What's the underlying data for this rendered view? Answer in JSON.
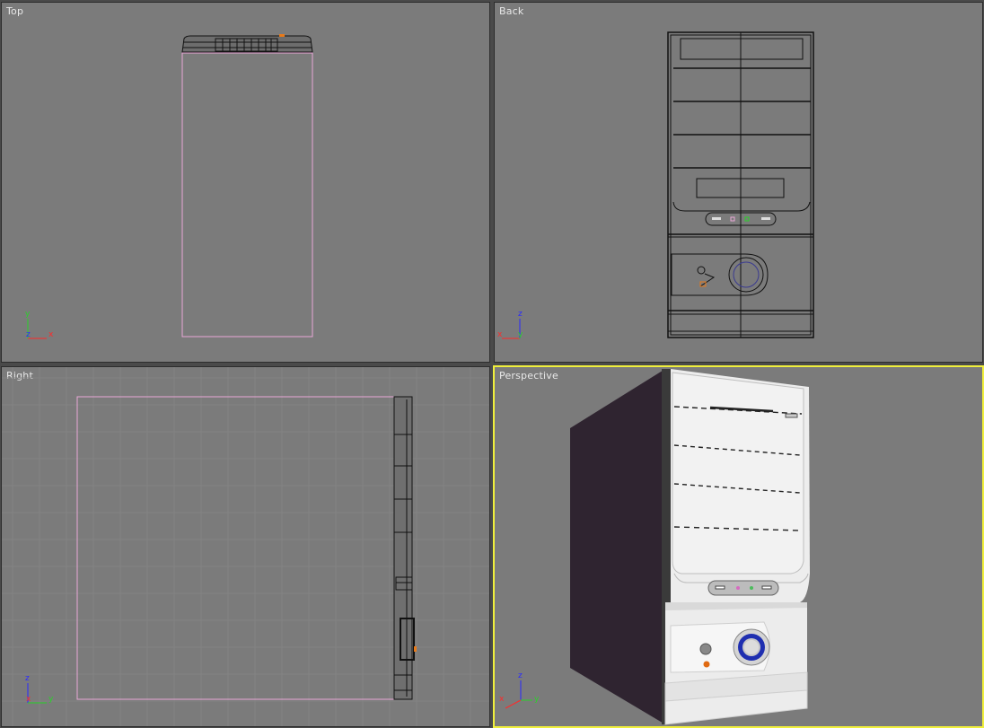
{
  "viewports": {
    "top": {
      "label": "Top"
    },
    "back": {
      "label": "Back"
    },
    "right": {
      "label": "Right"
    },
    "persp": {
      "label": "Perspective"
    }
  },
  "axes": {
    "top": {
      "up": "y",
      "center": "z",
      "right": "x"
    },
    "back": {
      "up": "z",
      "center": "x",
      "right": "y"
    },
    "right": {
      "up": "z",
      "center": "x",
      "right": "y"
    },
    "persp": {
      "up": "z",
      "center": "x",
      "right": "y"
    }
  },
  "colors": {
    "viewport_bg": "#7b7b7b",
    "active_border": "#f0ef3c",
    "wire": "#111111",
    "selection": "#e9a7d7",
    "axis_x": "#ff2a2a",
    "axis_y": "#2ad12a",
    "axis_z": "#2a2aff"
  }
}
